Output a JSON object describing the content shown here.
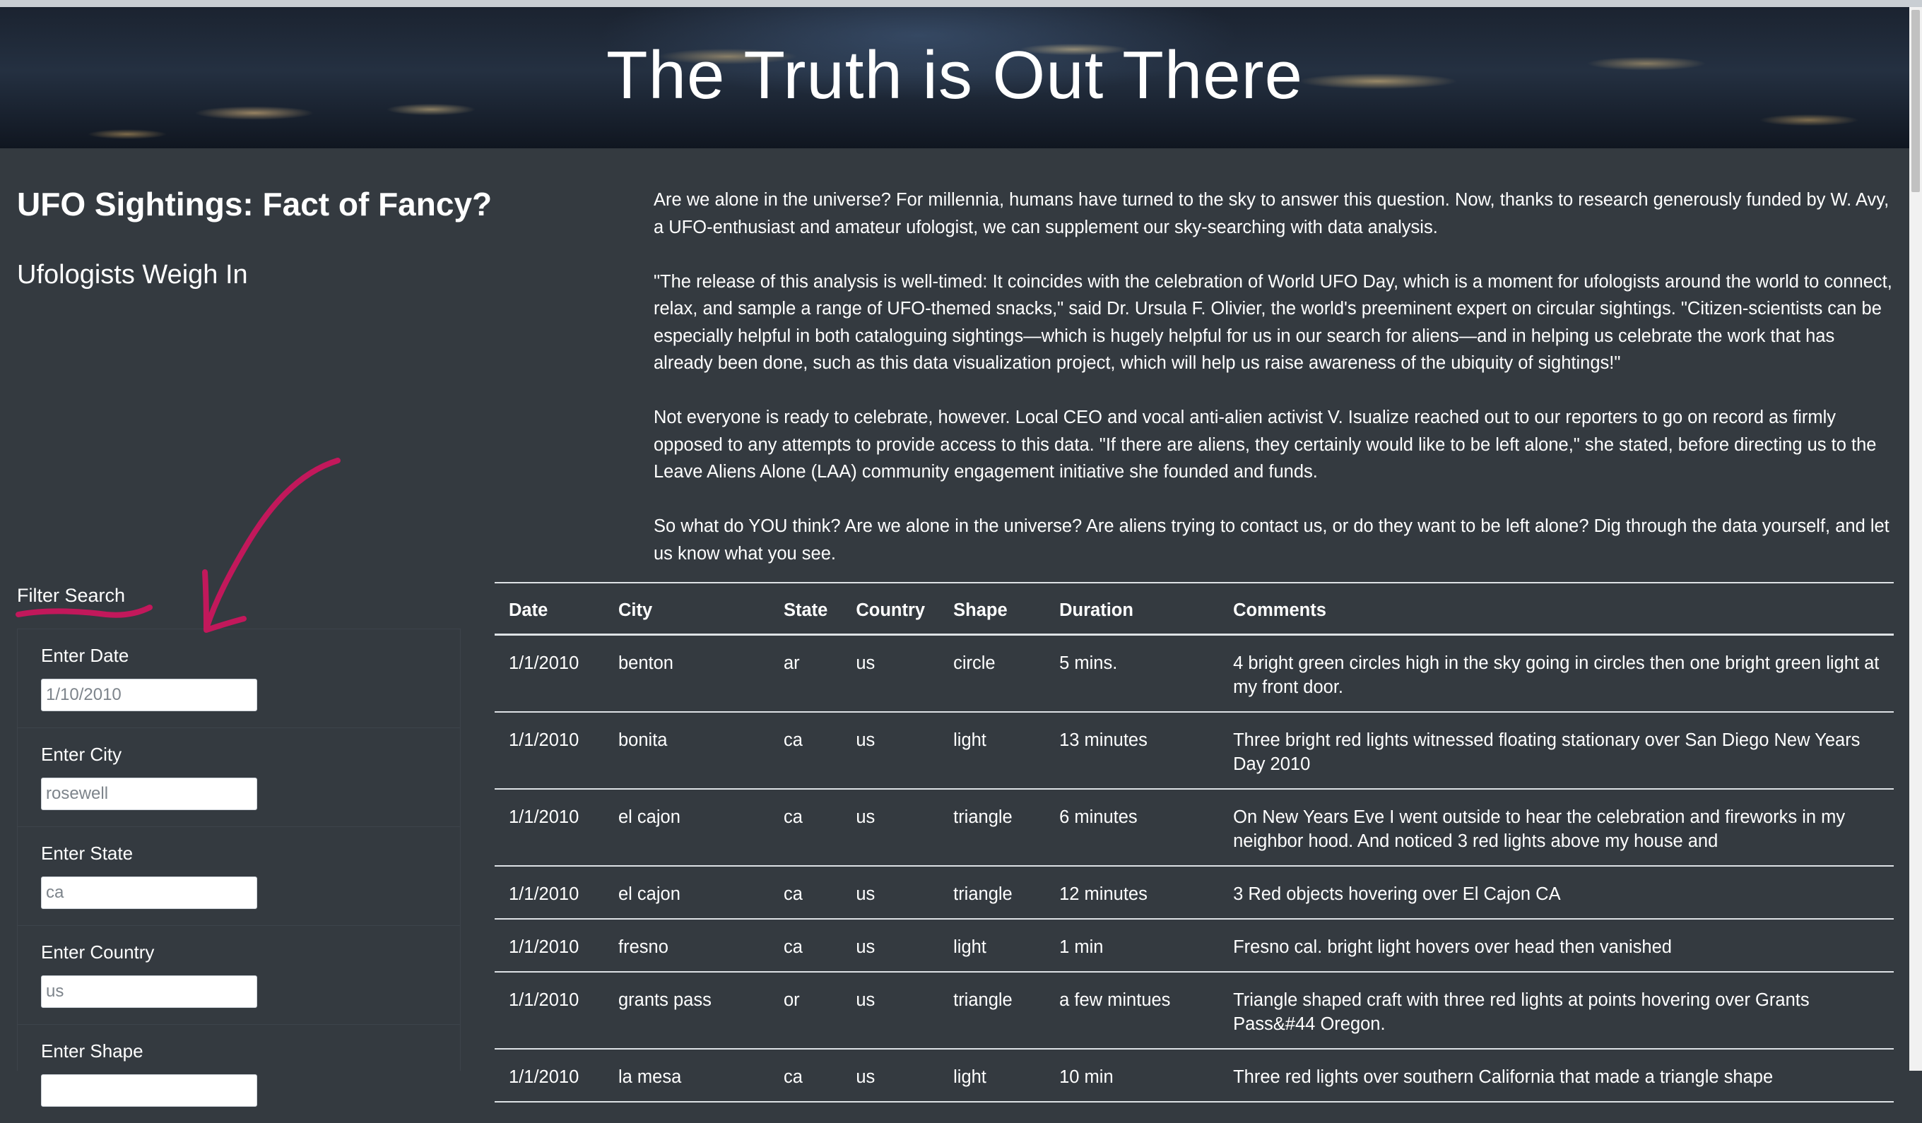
{
  "header": {
    "title": "The Truth is Out There"
  },
  "sidebar": {
    "title": "UFO Sightings: Fact of Fancy?",
    "subtitle": "Ufologists Weigh In",
    "filter_title": "Filter Search",
    "filters": [
      {
        "label": "Enter Date",
        "placeholder": "1/10/2010"
      },
      {
        "label": "Enter City",
        "placeholder": "rosewell"
      },
      {
        "label": "Enter State",
        "placeholder": "ca"
      },
      {
        "label": "Enter Country",
        "placeholder": "us"
      },
      {
        "label": "Enter Shape",
        "placeholder": ""
      }
    ]
  },
  "article": {
    "paragraphs": [
      "Are we alone in the universe? For millennia, humans have turned to the sky to answer this question. Now, thanks to research generously funded by W. Avy, a UFO-enthusiast and amateur ufologist, we can supplement our sky-searching with data analysis.",
      "\"The release of this analysis is well-timed: It coincides with the celebration of World UFO Day, which is a moment for ufologists around the world to connect, relax, and sample a range of UFO-themed snacks,\" said Dr. Ursula F. Olivier, the world's preeminent expert on circular sightings. \"Citizen-scientists can be especially helpful in both cataloguing sightings—which is hugely helpful for us in our search for aliens—and in helping us celebrate the work that has already been done, such as this data visualization project, which will help us raise awareness of the ubiquity of sightings!\"",
      "Not everyone is ready to celebrate, however. Local CEO and vocal anti-alien activist V. Isualize reached out to our reporters to go on record as firmly opposed to any attempts to provide access to this data. \"If there are aliens, they certainly would like to be left alone,\" she stated, before directing us to the Leave Aliens Alone (LAA) community engagement initiative she founded and funds.",
      "So what do YOU think? Are we alone in the universe? Are aliens trying to contact us, or do they want to be left alone? Dig through the data yourself, and let us know what you see."
    ]
  },
  "table": {
    "headers": [
      "Date",
      "City",
      "State",
      "Country",
      "Shape",
      "Duration",
      "Comments"
    ],
    "rows": [
      [
        "1/1/2010",
        "benton",
        "ar",
        "us",
        "circle",
        "5 mins.",
        "4 bright green circles high in the sky going in circles then one bright green light at my front door."
      ],
      [
        "1/1/2010",
        "bonita",
        "ca",
        "us",
        "light",
        "13 minutes",
        "Three bright red lights witnessed floating stationary over San Diego New Years Day 2010"
      ],
      [
        "1/1/2010",
        "el cajon",
        "ca",
        "us",
        "triangle",
        "6 minutes",
        "On New Years Eve I went outside to hear the celebration and fireworks in my neighbor hood. And noticed 3 red lights above my house and"
      ],
      [
        "1/1/2010",
        "el cajon",
        "ca",
        "us",
        "triangle",
        "12 minutes",
        "3 Red objects hovering over El Cajon CA"
      ],
      [
        "1/1/2010",
        "fresno",
        "ca",
        "us",
        "light",
        "1 min",
        "Fresno cal. bright light hovers over head then vanished"
      ],
      [
        "1/1/2010",
        "grants pass",
        "or",
        "us",
        "triangle",
        "a few mintues",
        "Triangle shaped craft with three red lights at points hovering over Grants Pass&#44 Oregon."
      ],
      [
        "1/1/2010",
        "la mesa",
        "ca",
        "us",
        "light",
        "10 min",
        "Three red lights over southern California that made a triangle shape"
      ]
    ]
  },
  "colors": {
    "page_background": "#343a40",
    "annotation_ink": "#c2185b"
  }
}
